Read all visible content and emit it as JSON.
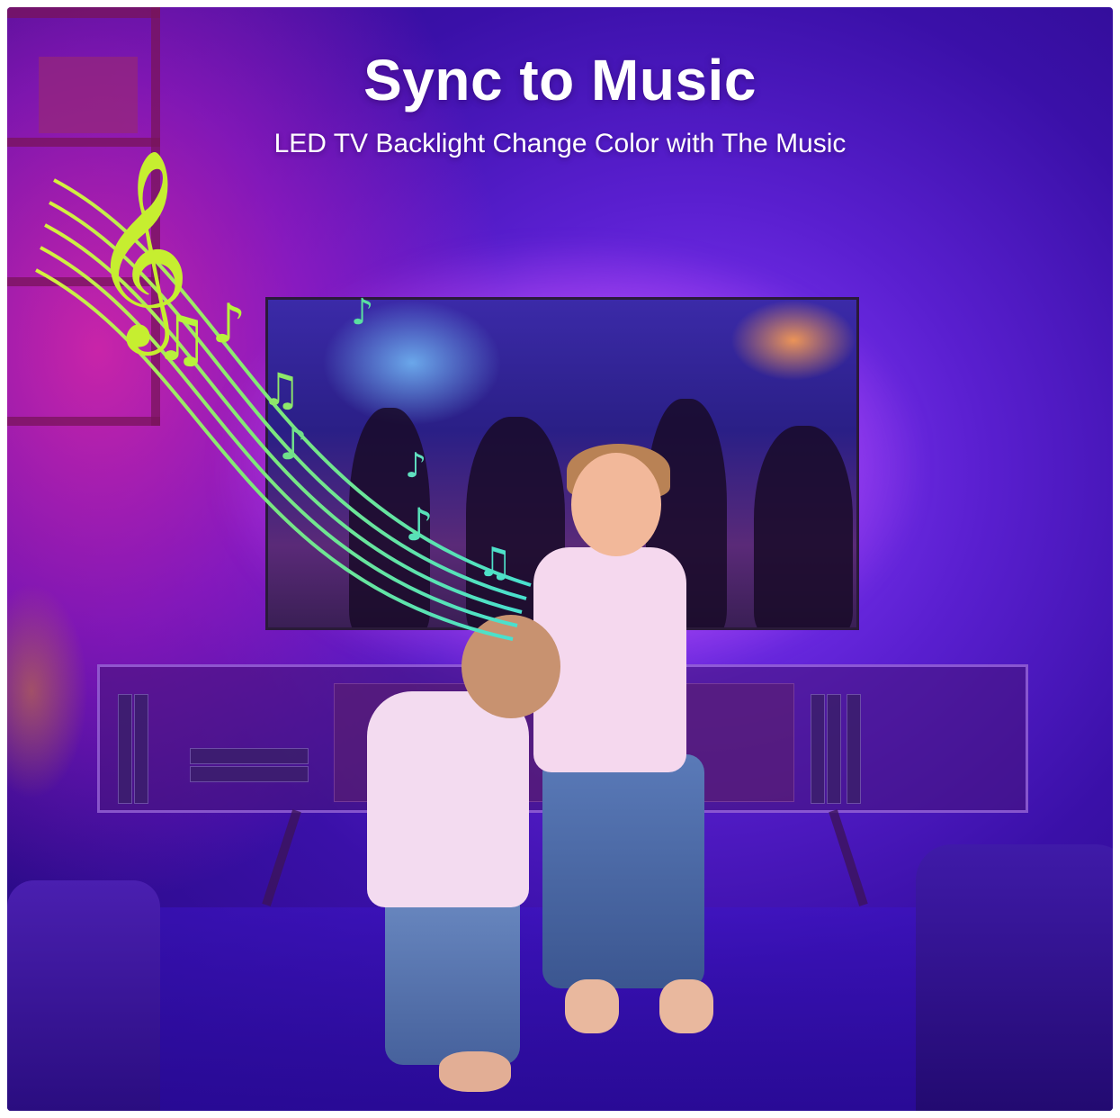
{
  "headline": "Sync to Music",
  "subheadline": "LED TV Backlight Change Color with The Music",
  "colors": {
    "backdrop_purple": "#5a1fd0",
    "backlight_pink": "#ff78ff",
    "staff_green": "#b8f23c",
    "staff_cyan": "#48e0d0",
    "text": "#ffffff"
  },
  "icons": [
    "treble-clef-icon",
    "music-note-icon"
  ]
}
